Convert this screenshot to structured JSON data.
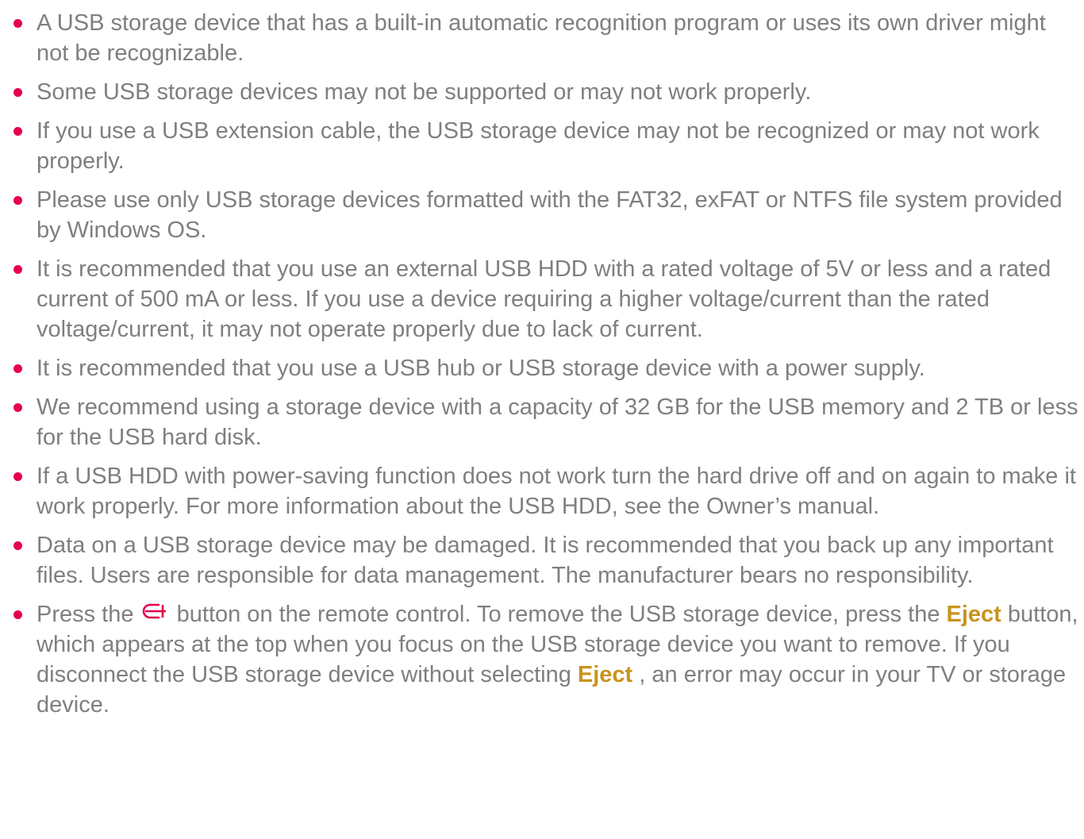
{
  "colors": {
    "text": "#7f7f7f",
    "bullet": "#e6004c",
    "highlight": "#c8941e",
    "icon": "#e6004c"
  },
  "notes": [
    "A USB storage device that has a built-in automatic recognition program or uses its own driver might not be recognizable.",
    "Some USB storage devices may not be supported or may not work properly.",
    "If you use a USB extension cable, the USB storage device may not be recognized or may not work properly.",
    "Please use only USB storage devices formatted with the FAT32, exFAT or NTFS file system provided by Windows OS.",
    "It is recommended that you use an external USB HDD with a rated voltage of 5V or less and a rated current of 500 mA or less. If you use a device requiring a higher voltage/current than the rated voltage/current, it may not operate properly due to lack of current.",
    "It is recommended that you use a USB hub or USB storage device with a power supply.",
    "We recommend using a storage device with a capacity of 32 GB for the USB memory and 2 TB or less for the USB hard disk.",
    "If a USB HDD with power-saving function does not work turn the hard drive off and on again to make it work properly. For more information about the USB HDD, see the Owner’s manual.",
    "Data on a USB storage device may be damaged. It is recommended that you back up any important files. Users are responsible for data management. The manufacturer bears no responsibility."
  ],
  "last_note": {
    "part1": "Press the",
    "icon": "input-source-icon",
    "part2": " button on the remote control. To remove the USB storage device, press the ",
    "eject1": "Eject",
    "part3": " button, which appears at the top when you focus on the USB storage device you want to remove. If you disconnect the USB storage device without selecting ",
    "eject2": "Eject",
    "part4": ", an error may occur in your TV or storage device."
  }
}
